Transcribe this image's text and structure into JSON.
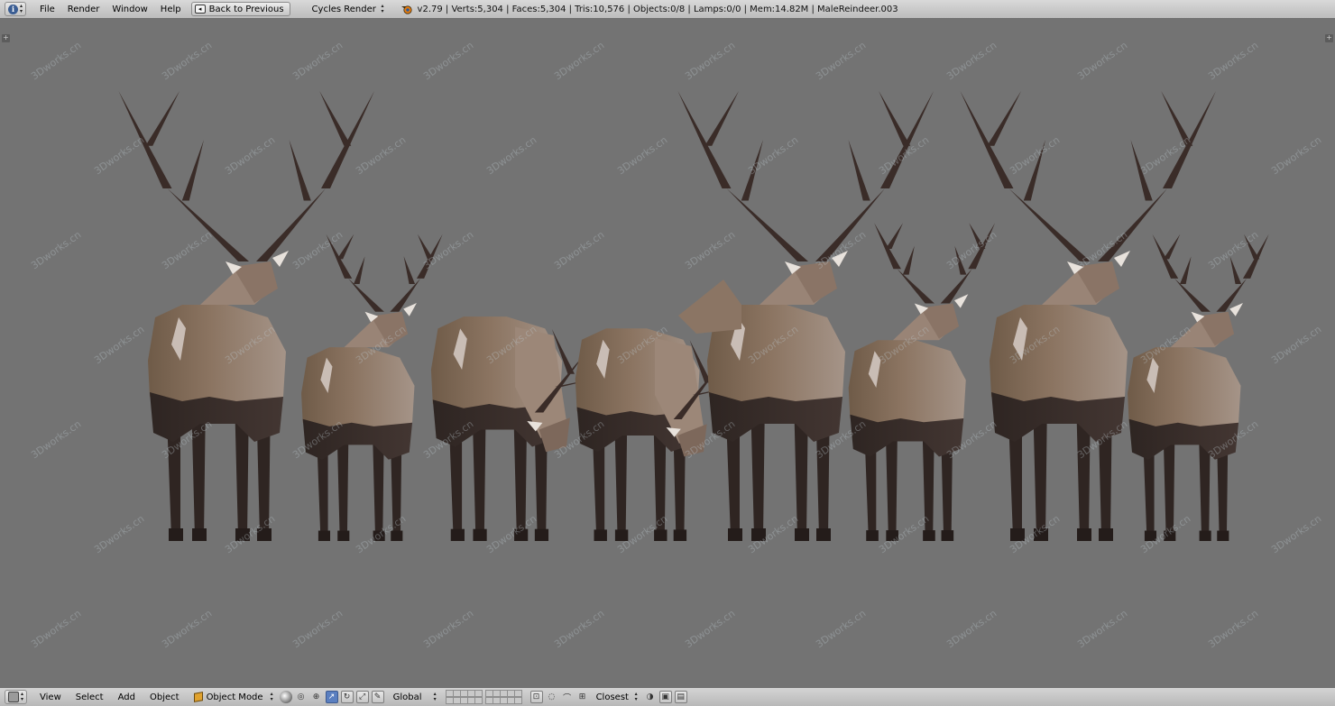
{
  "header": {
    "editor_icon": "info-icon",
    "menus": [
      "File",
      "Render",
      "Window",
      "Help"
    ],
    "back_button": "Back to Previous",
    "render_engine": "Cycles Render",
    "stats": "v2.79 | Verts:5,304 | Faces:5,304 | Tris:10,576 | Objects:0/8 | Lamps:0/0 | Mem:14.82M | MaleReindeer.003"
  },
  "viewport": {
    "background_color": "#737373",
    "watermark": "3Dworks.cn",
    "reindeer_count": 8
  },
  "footer": {
    "editor_icon": "3d-view-icon",
    "menus": [
      "View",
      "Select",
      "Add",
      "Object"
    ],
    "mode": "Object Mode",
    "orientation": "Global",
    "snap_target": "Closest"
  }
}
